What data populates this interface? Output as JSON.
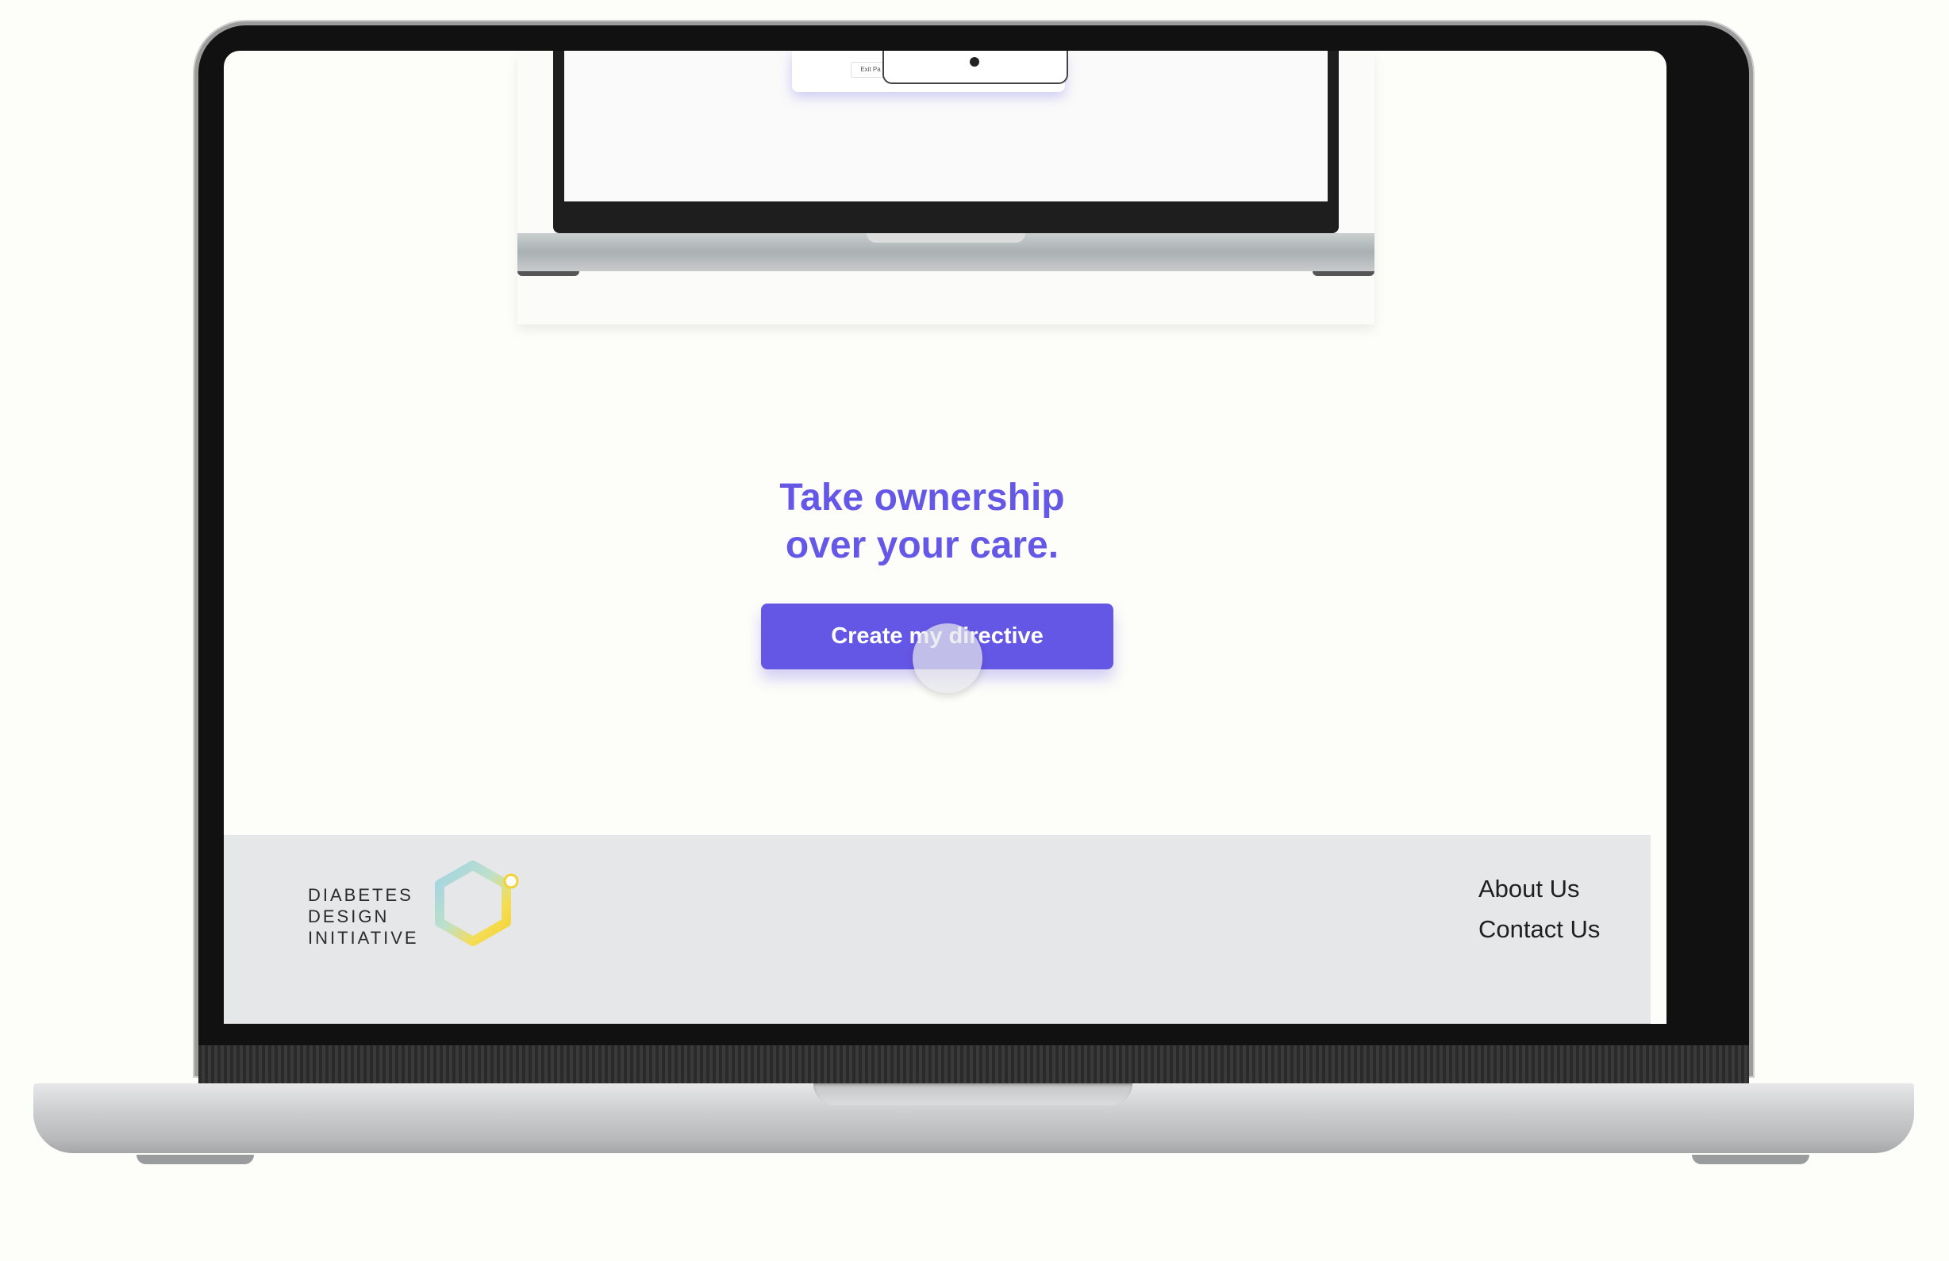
{
  "inner_preview": {
    "popup_button_label": "Exit Pa"
  },
  "hero": {
    "heading_line1": "Take ownership",
    "heading_line2": "over your care.",
    "cta_label": "Create my directive"
  },
  "footer": {
    "logo_line1": "DIABETES",
    "logo_line2": "DESIGN",
    "logo_line3": "INITIATIVE",
    "logo_icon": "hexagon-logo-icon",
    "links": [
      {
        "label": "About Us"
      },
      {
        "label": "Contact Us"
      }
    ]
  },
  "colors": {
    "accent": "#6557e6",
    "footer_bg": "#e6e7e8",
    "page_bg": "#fdfdf9"
  }
}
